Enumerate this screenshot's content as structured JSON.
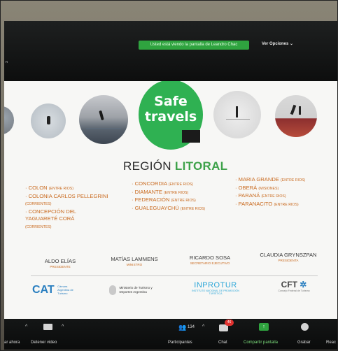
{
  "zoom": {
    "share_banner": "Usted está viendo la pantalla de Leandro Chac",
    "view_options": "Ver Opciones",
    "toolbar": {
      "stop_audio": "ar ahora",
      "stop_video": "Detener video",
      "participants_count": "134",
      "participants": "Participantes",
      "chat_badge": "46",
      "chat": "Chat",
      "share_screen": "Compartir pantalla",
      "record": "Grabar",
      "reactions": "Reac"
    }
  },
  "slide": {
    "badge": {
      "line1": "Safe",
      "line2": "travels"
    },
    "region_title": "REGIÓN",
    "region_highlight": "LITORAL",
    "col1": [
      {
        "name": "COLON",
        "sub": "(ENTRE RIOS)"
      },
      {
        "name": "COLONIA CARLOS PELLEGRINI",
        "sub": "(CORRIENTES)"
      },
      {
        "name": "CONCEPCIÓN DEL YAGUARETÉ CORÁ",
        "sub": "(CORRIENTES)"
      }
    ],
    "col2": [
      {
        "name": "CONCORDIA",
        "sub": "(ENTRE RIOS)"
      },
      {
        "name": "DIAMANTE",
        "sub": "(ENTRE RIOS)"
      },
      {
        "name": "FEDERACIÓN",
        "sub": "(ENTRE RIOS)"
      },
      {
        "name": "GUALEGUAYCHÚ",
        "sub": "(ENTRE RIOS)"
      }
    ],
    "col3": [
      {
        "name": "MARIA GRANDE",
        "sub": "(ENTRE RIOS)"
      },
      {
        "name": "OBERÁ",
        "sub": "(MISIONES)"
      },
      {
        "name": "PARANÁ",
        "sub": "(ENTRE RIOS)"
      },
      {
        "name": "PARANACITO",
        "sub": "(ENTRE RIOS)"
      }
    ],
    "people": [
      {
        "name": "ALDO ELÍAS",
        "role": "PRESIDENTE"
      },
      {
        "name": "MATÍAS LAMMENS",
        "role": "MINISTRO"
      },
      {
        "name": "RICARDO SOSA",
        "role": "SECRETARIO EJECUTIVO"
      },
      {
        "name": "CLAUDIA GRYNSZPAN",
        "role": "PRESIDENTA"
      }
    ],
    "logos": {
      "cat": "CAT",
      "cat_sub": "Cámara Argentina de Turismo",
      "ministry": "Ministerio de Turismo y Deportes Argentina",
      "inprotur": "INPROTUR",
      "inprotur_sub": "INSTITUTO NACIONAL DE PROMOCIÓN TURÍSTICA",
      "cft": "CFT",
      "cft_sub": "Consejo Federal de Turismo"
    }
  }
}
